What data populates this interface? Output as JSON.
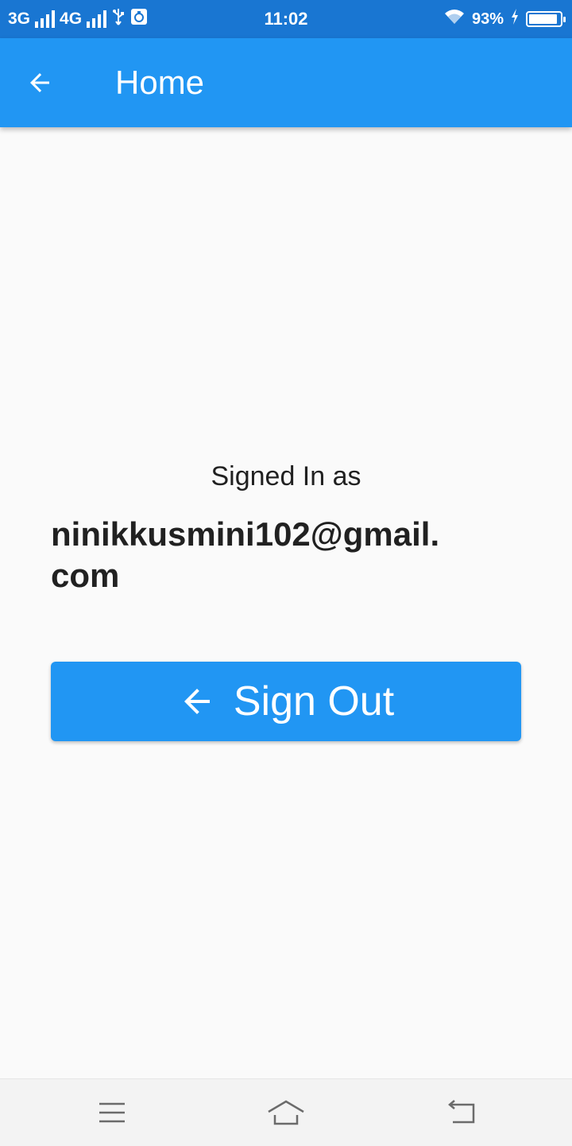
{
  "status_bar": {
    "network_1": "3G",
    "network_2": "4G",
    "time": "11:02",
    "battery_percent": "93%",
    "battery_level": 0.93,
    "icons": [
      "signal-icon",
      "usb-icon",
      "notification-icon",
      "wifi-icon",
      "charging-icon",
      "battery-icon"
    ]
  },
  "app_bar": {
    "title": "Home",
    "back_icon": "arrow-back-icon",
    "color": "#2196f3"
  },
  "main": {
    "signed_label": "Signed In as",
    "email": "ninikkusmini102@gmail.com",
    "signout_button": {
      "label": "Sign Out",
      "icon": "arrow-back-icon",
      "color": "#2196f3"
    }
  },
  "nav_bar": {
    "icons": [
      "menu-icon",
      "home-icon",
      "back-icon"
    ]
  }
}
